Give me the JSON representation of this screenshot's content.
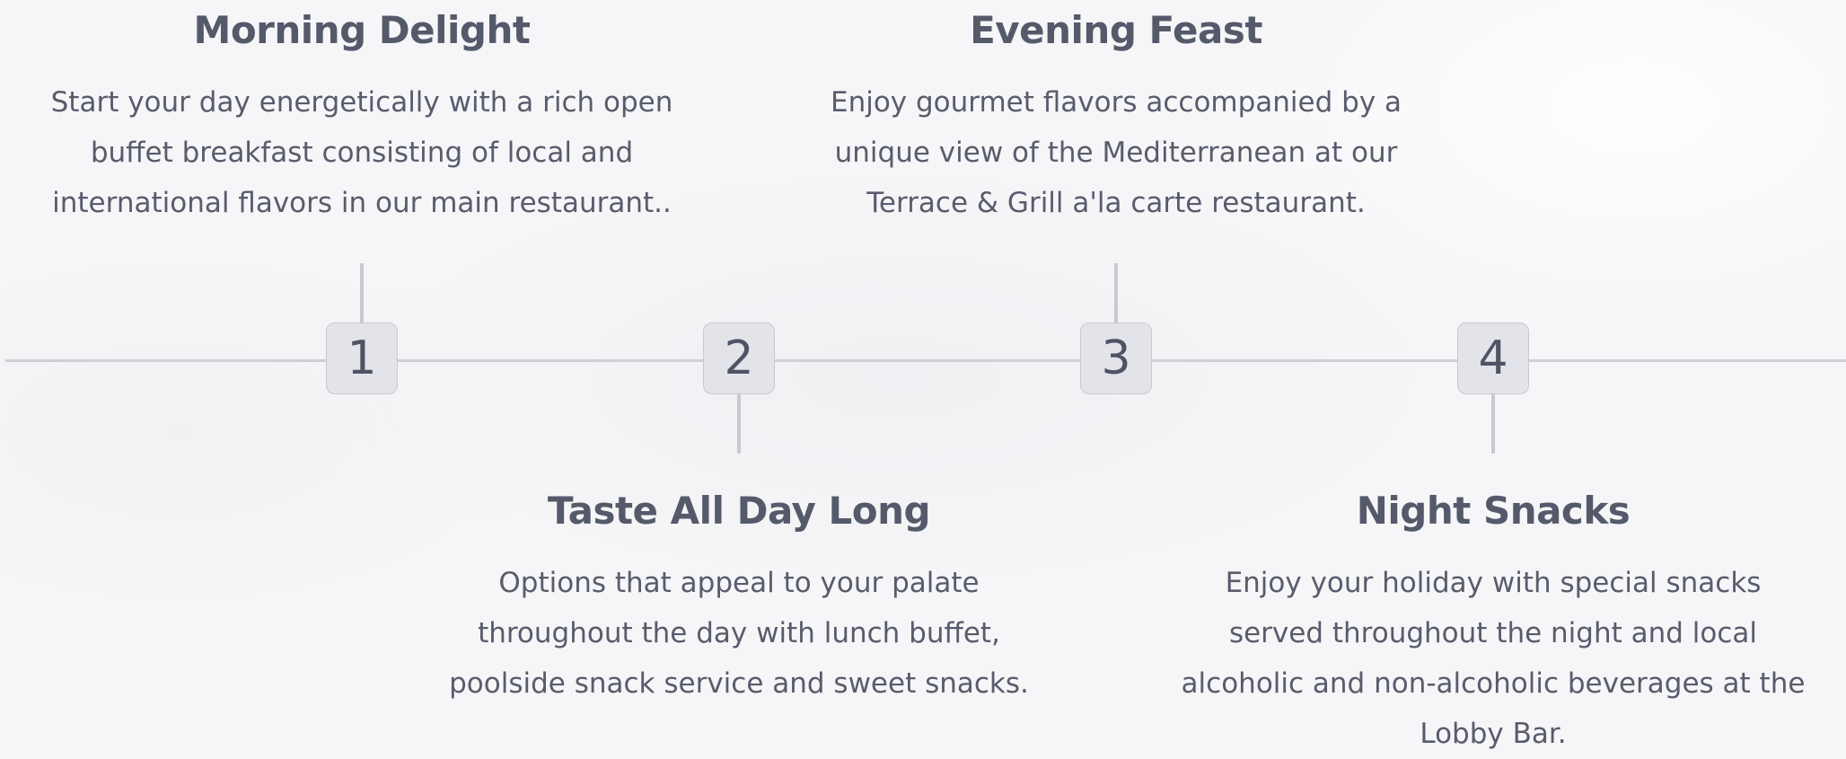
{
  "steps": [
    {
      "number": "1",
      "title": "Morning Delight",
      "text": "Start your day energetically with a rich open buffet breakfast consisting of local and international flavors in our main restaurant.."
    },
    {
      "number": "2",
      "title": "Taste All Day Long",
      "text": "Options that appeal to your palate throughout the day with lunch buffet, poolside snack service and sweet snacks."
    },
    {
      "number": "3",
      "title": "Evening Feast",
      "text": "Enjoy gourmet flavors accompanied by a unique view of the Mediterranean at our Terrace & Grill a'la carte restaurant."
    },
    {
      "number": "4",
      "title": "Night Snacks",
      "text": "Enjoy your holiday with special snacks served throughout the night and local alcoholic and non-alcoholic beverages at the Lobby Bar."
    }
  ]
}
